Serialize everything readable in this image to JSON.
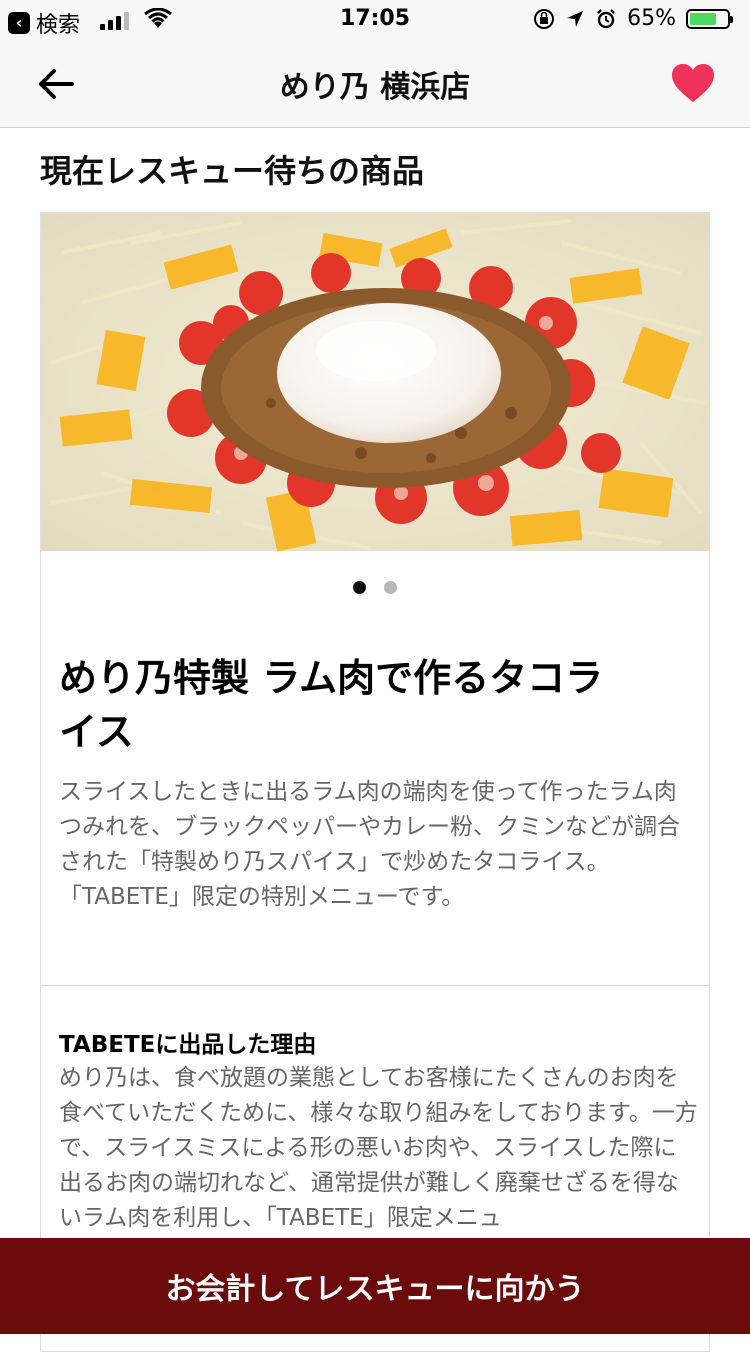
{
  "status_bar": {
    "back_app_label": "検索",
    "time": "17:05",
    "battery_percent": "65%",
    "battery_level": 0.65,
    "battery_color": "#4cd964"
  },
  "nav": {
    "title": "めり乃 横浜店",
    "back_icon": "arrow-left-icon",
    "favorite_icon": "heart-icon",
    "favorite_color": "#f0325a"
  },
  "section": {
    "heading": "現在レスキュー待ちの商品"
  },
  "product": {
    "carousel": {
      "total": 2,
      "active_index": 0
    },
    "title": "めり乃特製 ラム肉で作るタコライス",
    "description": "スライスしたときに出るラム肉の端肉を使って作ったラム肉つみれを、ブラックペッパーやカレー粉、クミンなどが調合された「特製めり乃スパイス」で炒めたタコライス。「TABETE」限定の特別メニューです。"
  },
  "reason": {
    "heading": "TABETEに出品した理由",
    "body": "めり乃は、食べ放題の業態としてお客様にたくさんのお肉を食べていただくために、様々な取り組みをしております。一方で、スライスミスによる形の悪いお肉や、スライスした際に出るお肉の端切れなど、通常提供が難しく廃棄せざるを得ないラム肉を利用し、「TABETE」限定メニュ"
  },
  "cta": {
    "label": "お会計してレスキューに向かう",
    "color": "#6b0b0b"
  }
}
